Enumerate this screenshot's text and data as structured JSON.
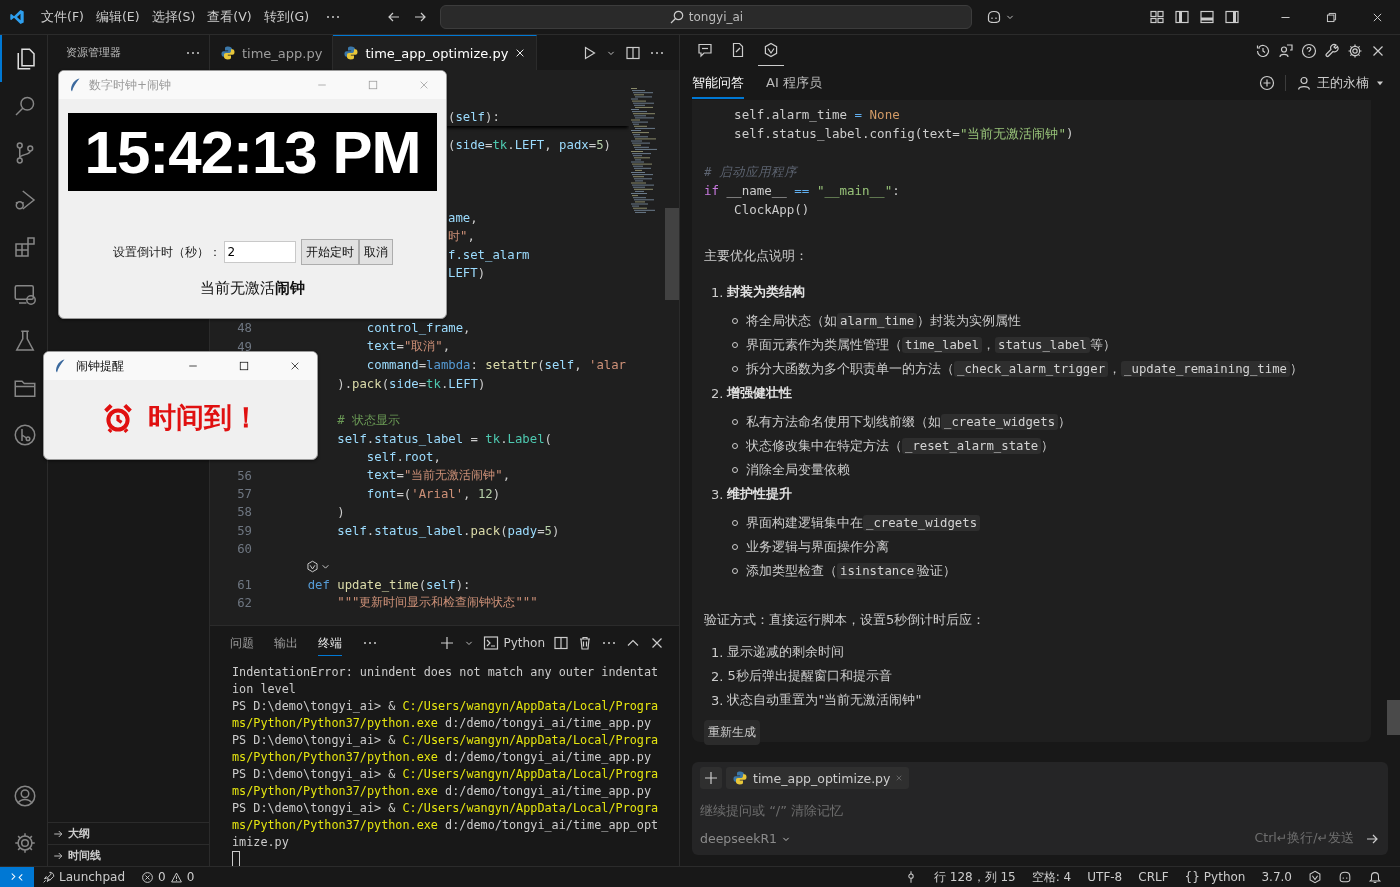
{
  "title_bar": {
    "menus": [
      "文件(F)",
      "编辑(E)",
      "选择(S)",
      "查看(V)",
      "转到(G)"
    ],
    "search": "tongyi_ai"
  },
  "activity_bar": {
    "top": [
      {
        "kind": "files",
        "selected": true
      },
      {
        "kind": "search",
        "selected": false
      },
      {
        "kind": "scm",
        "selected": false
      },
      {
        "kind": "run",
        "selected": false
      },
      {
        "kind": "extensions",
        "selected": false
      },
      {
        "kind": "remote",
        "selected": false
      },
      {
        "kind": "testing",
        "selected": false
      },
      {
        "kind": "folder",
        "selected": false
      },
      {
        "kind": "graph",
        "selected": false
      }
    ],
    "bottom": [
      {
        "kind": "account",
        "selected": false
      },
      {
        "kind": "settings",
        "selected": false
      }
    ]
  },
  "sidebar": {
    "title": "资源管理器",
    "sections": [
      {
        "label": "大纲",
        "expanded": false
      },
      {
        "label": "时间线",
        "expanded": false
      }
    ]
  },
  "editor": {
    "tabs": [
      {
        "label": "time_app.py",
        "selected": false
      },
      {
        "label": "time_app_optimize.py",
        "selected": true
      }
    ],
    "sticky": [
      {
        "text": "(",
        "kind": "plain"
      },
      {
        "text": "self",
        "kind": "var"
      },
      {
        "text": "):",
        "kind": "plain"
      }
    ],
    "lines": [
      {
        "kind": "partial",
        "segs": [
          {
            "text": "(",
            "kind": "plain"
          },
          {
            "text": "side",
            "kind": "var"
          },
          {
            "text": "=",
            "kind": "plain"
          },
          {
            "text": "tk",
            "kind": "type"
          },
          {
            "text": ".",
            "kind": "plain"
          },
          {
            "text": "LEFT",
            "kind": "var"
          },
          {
            "text": ", ",
            "kind": "plain"
          },
          {
            "text": "padx",
            "kind": "var"
          },
          {
            "text": "=",
            "kind": "plain"
          },
          {
            "text": "5",
            "kind": "number"
          },
          {
            "text": ")",
            "kind": "plain"
          }
        ]
      },
      {
        "kind": "blank"
      },
      {
        "kind": "blank"
      },
      {
        "kind": "blank"
      },
      {
        "kind": "partial",
        "segs": [
          {
            "text": "ame",
            "kind": "var"
          },
          {
            "text": ",",
            "kind": "plain"
          }
        ]
      },
      {
        "kind": "partial",
        "segs": [
          {
            "text": "时\"",
            "kind": "string"
          },
          {
            "text": ",",
            "kind": "plain"
          }
        ]
      },
      {
        "kind": "partial",
        "segs": [
          {
            "text": "f.set_alarm",
            "kind": "var"
          }
        ]
      },
      {
        "kind": "partial",
        "segs": [
          {
            "text": "LEFT",
            "kind": "var"
          },
          {
            "text": ")",
            "kind": "plain"
          }
        ]
      },
      {
        "kind": "blank"
      },
      {
        "kind": "blank"
      },
      {
        "kind": "full",
        "number": "48",
        "segs": [
          {
            "text": "            control_frame",
            "kind": "var"
          },
          {
            "text": ",",
            "kind": "plain"
          }
        ]
      },
      {
        "kind": "full",
        "number": "49",
        "segs": [
          {
            "text": "            text",
            "kind": "var"
          },
          {
            "text": "=",
            "kind": "plain"
          },
          {
            "text": "\"取消\"",
            "kind": "string"
          },
          {
            "text": ",",
            "kind": "plain"
          }
        ]
      },
      {
        "kind": "full",
        "segs": [
          {
            "text": "            command",
            "kind": "var"
          },
          {
            "text": "=",
            "kind": "plain"
          },
          {
            "text": "lambda",
            "kind": "keyword"
          },
          {
            "text": ": ",
            "kind": "plain"
          },
          {
            "text": "setattr",
            "kind": "func"
          },
          {
            "text": "(",
            "kind": "plain"
          },
          {
            "text": "self",
            "kind": "var"
          },
          {
            "text": ", ",
            "kind": "plain"
          },
          {
            "text": "'alar",
            "kind": "string"
          }
        ]
      },
      {
        "kind": "full",
        "segs": [
          {
            "text": "        ).",
            "kind": "plain"
          },
          {
            "text": "pack",
            "kind": "func"
          },
          {
            "text": "(",
            "kind": "plain"
          },
          {
            "text": "side",
            "kind": "var"
          },
          {
            "text": "=",
            "kind": "plain"
          },
          {
            "text": "tk",
            "kind": "type"
          },
          {
            "text": ".",
            "kind": "plain"
          },
          {
            "text": "LEFT",
            "kind": "var"
          },
          {
            "text": ")",
            "kind": "plain"
          }
        ]
      },
      {
        "kind": "blank"
      },
      {
        "kind": "full",
        "segs": [
          {
            "text": "        # 状态显示",
            "kind": "comment"
          }
        ]
      },
      {
        "kind": "full",
        "segs": [
          {
            "text": "        self",
            "kind": "var"
          },
          {
            "text": ".",
            "kind": "plain"
          },
          {
            "text": "status_label",
            "kind": "var"
          },
          {
            "text": " = ",
            "kind": "plain"
          },
          {
            "text": "tk",
            "kind": "type"
          },
          {
            "text": ".",
            "kind": "plain"
          },
          {
            "text": "Label",
            "kind": "type"
          },
          {
            "text": "(",
            "kind": "plain"
          }
        ]
      },
      {
        "kind": "full",
        "segs": [
          {
            "text": "            self",
            "kind": "var"
          },
          {
            "text": ".",
            "kind": "plain"
          },
          {
            "text": "root",
            "kind": "var"
          },
          {
            "text": ",",
            "kind": "plain"
          }
        ]
      },
      {
        "kind": "full",
        "number": "56",
        "segs": [
          {
            "text": "            text",
            "kind": "var"
          },
          {
            "text": "=",
            "kind": "plain"
          },
          {
            "text": "\"当前无激活闹钟\"",
            "kind": "string"
          },
          {
            "text": ",",
            "kind": "plain"
          }
        ]
      },
      {
        "kind": "full",
        "number": "57",
        "segs": [
          {
            "text": "            font",
            "kind": "var"
          },
          {
            "text": "=(",
            "kind": "plain"
          },
          {
            "text": "'Arial'",
            "kind": "string"
          },
          {
            "text": ", ",
            "kind": "plain"
          },
          {
            "text": "12",
            "kind": "number"
          },
          {
            "text": ")",
            "kind": "plain"
          }
        ]
      },
      {
        "kind": "full",
        "number": "58",
        "segs": [
          {
            "text": "        )",
            "kind": "plain"
          }
        ]
      },
      {
        "kind": "full",
        "number": "59",
        "segs": [
          {
            "text": "        self",
            "kind": "var"
          },
          {
            "text": ".",
            "kind": "plain"
          },
          {
            "text": "status_label",
            "kind": "var"
          },
          {
            "text": ".",
            "kind": "plain"
          },
          {
            "text": "pack",
            "kind": "func"
          },
          {
            "text": "(",
            "kind": "plain"
          },
          {
            "text": "pady",
            "kind": "var"
          },
          {
            "text": "=",
            "kind": "plain"
          },
          {
            "text": "5",
            "kind": "number"
          },
          {
            "text": ")",
            "kind": "plain"
          }
        ]
      },
      {
        "kind": "full",
        "number": "60"
      },
      {
        "kind": "codelens"
      },
      {
        "kind": "full",
        "number": "61",
        "segs": [
          {
            "text": "    def ",
            "kind": "keyword"
          },
          {
            "text": "update_time",
            "kind": "func"
          },
          {
            "text": "(",
            "kind": "plain"
          },
          {
            "text": "self",
            "kind": "var"
          },
          {
            "text": "):",
            "kind": "plain"
          }
        ]
      },
      {
        "kind": "full",
        "number": "62",
        "segs": [
          {
            "text": "        \"\"\"更新时间显示和检查闹钟状态\"\"\"",
            "kind": "string"
          }
        ]
      }
    ]
  },
  "terminal": {
    "tabs": [
      {
        "label": "问题",
        "selected": false
      },
      {
        "label": "输出",
        "selected": false
      },
      {
        "label": "终端",
        "selected": true
      }
    ],
    "profile": "Python",
    "lines": [
      [
        {
          "text": "IndentationError: unindent does not match any outer indentat",
          "kind": "plain"
        }
      ],
      [
        {
          "text": "ion level",
          "kind": "plain"
        }
      ],
      [
        {
          "text": "PS D:\\demo\\tongyi_ai> & ",
          "kind": "plain"
        },
        {
          "text": "C:/Users/wangyn/AppData/Local/Progra",
          "kind": "path"
        }
      ],
      [
        {
          "text": "ms/Python/Python37/python.exe ",
          "kind": "path"
        },
        {
          "text": "d:/demo/tongyi_ai/time_app.py",
          "kind": "plain"
        }
      ],
      [
        {
          "text": "PS D:\\demo\\tongyi_ai> & ",
          "kind": "plain"
        },
        {
          "text": "C:/Users/wangyn/AppData/Local/Progra",
          "kind": "path"
        }
      ],
      [
        {
          "text": "ms/Python/Python37/python.exe ",
          "kind": "path"
        },
        {
          "text": "d:/demo/tongyi_ai/time_app.py",
          "kind": "plain"
        }
      ],
      [
        {
          "text": "PS D:\\demo\\tongyi_ai> & ",
          "kind": "plain"
        },
        {
          "text": "C:/Users/wangyn/AppData/Local/Progra",
          "kind": "path"
        }
      ],
      [
        {
          "text": "ms/Python/Python37/python.exe ",
          "kind": "path"
        },
        {
          "text": "d:/demo/tongyi_ai/time_app.py",
          "kind": "plain"
        }
      ],
      [
        {
          "text": "PS D:\\demo\\tongyi_ai> & ",
          "kind": "plain"
        },
        {
          "text": "C:/Users/wangyn/AppData/Local/Progra",
          "kind": "path"
        }
      ],
      [
        {
          "text": "ms/Python/Python37/python.exe ",
          "kind": "path"
        },
        {
          "text": "d:/demo/tongyi_ai/time_app_opt",
          "kind": "plain"
        }
      ],
      [
        {
          "text": "imize.py",
          "kind": "plain"
        }
      ]
    ]
  },
  "assistant": {
    "toolbar": [
      {
        "kind": "chat",
        "selected": false
      },
      {
        "kind": "doc",
        "selected": false
      },
      {
        "kind": "tongyi",
        "selected": true
      }
    ],
    "tabs": [
      {
        "label": "智能问答",
        "selected": true
      },
      {
        "label": "AI 程序员",
        "selected": false
      }
    ],
    "user": "王的永楠",
    "code": [
      {
        "kind": "code",
        "segs": [
          {
            "text": "    self.alarm_time ",
            "kind": "plain"
          },
          {
            "text": "= ",
            "kind": "keyword"
          },
          {
            "text": "None",
            "kind": "constant"
          }
        ]
      },
      {
        "kind": "code",
        "segs": [
          {
            "text": "    self.status_label.config(text=",
            "kind": "plain"
          },
          {
            "text": "\"当前无激活闹钟\"",
            "kind": "string"
          },
          {
            "text": ")",
            "kind": "plain"
          }
        ]
      },
      {
        "kind": "blank"
      },
      {
        "kind": "code",
        "segs": [
          {
            "text": "# 启动应用程序",
            "kind": "comment"
          }
        ]
      },
      {
        "kind": "code",
        "segs": [
          {
            "text": "if",
            "kind": "control"
          },
          {
            "text": " __name__ ",
            "kind": "plain"
          },
          {
            "text": "== ",
            "kind": "keyword"
          },
          {
            "text": "\"__main__\"",
            "kind": "string"
          },
          {
            "text": ":",
            "kind": "plain"
          }
        ]
      },
      {
        "kind": "code",
        "segs": [
          {
            "text": "    ClockApp()",
            "kind": "plain"
          }
        ]
      }
    ],
    "intro": "主要优化点说明：",
    "sections": [
      {
        "marker": "1.",
        "title": "封装为类结构",
        "items": [
          [
            {
              "text": "将全局状态（如",
              "kind": "text"
            },
            {
              "text": "alarm_time",
              "kind": "code"
            },
            {
              "text": "）封装为实例属性",
              "kind": "text"
            }
          ],
          [
            {
              "text": "界面元素作为类属性管理（",
              "kind": "text"
            },
            {
              "text": "time_label",
              "kind": "code"
            },
            {
              "text": "，",
              "kind": "text"
            },
            {
              "text": "status_label",
              "kind": "code"
            },
            {
              "text": "等）",
              "kind": "text"
            }
          ],
          [
            {
              "text": "拆分大函数为多个职责单一的方法（",
              "kind": "text"
            },
            {
              "text": "_check_alarm_trigger",
              "kind": "code"
            },
            {
              "text": "，",
              "kind": "text"
            },
            {
              "text": "_update_remaining_time",
              "kind": "code"
            },
            {
              "text": "）",
              "kind": "text"
            }
          ]
        ]
      },
      {
        "marker": "2.",
        "title": "增强健壮性",
        "items": [
          [
            {
              "text": "私有方法命名使用下划线前缀（如",
              "kind": "text"
            },
            {
              "text": "_create_widgets",
              "kind": "code"
            },
            {
              "text": "）",
              "kind": "text"
            }
          ],
          [
            {
              "text": "状态修改集中在特定方法（",
              "kind": "text"
            },
            {
              "text": "_reset_alarm_state",
              "kind": "code"
            },
            {
              "text": "）",
              "kind": "text"
            }
          ],
          [
            {
              "text": "消除全局变量依赖",
              "kind": "text"
            }
          ]
        ]
      },
      {
        "marker": "3.",
        "title": "维护性提升",
        "items": [
          [
            {
              "text": "界面构建逻辑集中在",
              "kind": "text"
            },
            {
              "text": "_create_widgets",
              "kind": "code"
            }
          ],
          [
            {
              "text": "业务逻辑与界面操作分离",
              "kind": "text"
            }
          ],
          [
            {
              "text": "添加类型检查（",
              "kind": "text"
            },
            {
              "text": "isinstance",
              "kind": "code"
            },
            {
              "text": "验证）",
              "kind": "text"
            }
          ]
        ]
      }
    ],
    "verify": "验证方式：直接运行脚本，设置5秒倒计时后应：",
    "steps": [
      {
        "marker": "1.",
        "text": "显示递减的剩余时间"
      },
      {
        "marker": "2.",
        "text": "5秒后弹出提醒窗口和提示音"
      },
      {
        "marker": "3.",
        "text": "状态自动重置为\"当前无激活闹钟\""
      }
    ],
    "regenerate": "重新生成",
    "composer": {
      "attachment": "time_app_optimize.py",
      "placeholder": "继续提问或 “/” 清除记忆",
      "model": "deepseekR1",
      "hint": "Ctrl↵换行/↵发送"
    }
  },
  "status_bar": {
    "launchpad": "Launchpad",
    "errors": "0",
    "warnings": "0",
    "position": "行 128，列 15",
    "spaces": "空格: 4",
    "encoding": "UTF-8",
    "eol": "CRLF",
    "language_glyph": "{}",
    "language": "Python",
    "version": "3.7.0"
  },
  "clock_window": {
    "title": "数字时钟+闹钟",
    "active": false,
    "time": "15:42:13 PM",
    "countdown_label": "设置倒计时（秒）：",
    "countdown_value": "2",
    "buttons": [
      "开始定时",
      "取消"
    ],
    "status": "当前无激活**闹钟**"
  },
  "alarm_window": {
    "title": "闹钟提醒",
    "active": true,
    "message": "时间到！"
  }
}
